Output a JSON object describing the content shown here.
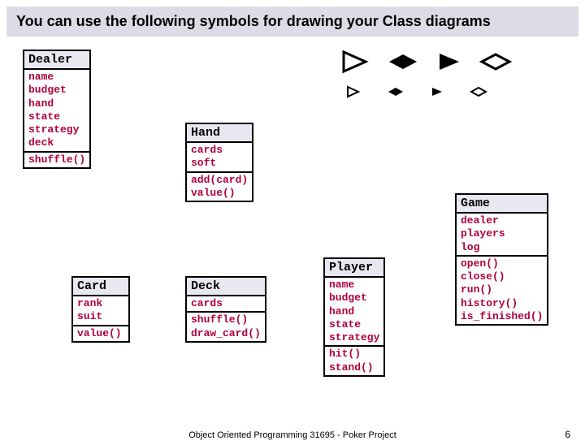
{
  "title": "You can use the following symbols for drawing your Class diagrams",
  "footer": "Object Oriented Programming 31695 - Poker Project",
  "page_number": "6",
  "classes": {
    "dealer": {
      "name": "Dealer",
      "attrs": [
        "name",
        "budget",
        "hand",
        "state",
        "strategy",
        "deck"
      ],
      "methods": [
        "shuffle()"
      ]
    },
    "hand": {
      "name": "Hand",
      "attrs": [
        "cards",
        "soft"
      ],
      "methods": [
        "add(card)",
        "value()"
      ]
    },
    "card": {
      "name": "Card",
      "attrs": [
        "rank",
        "suit"
      ],
      "methods": [
        "value()"
      ]
    },
    "deck": {
      "name": "Deck",
      "attrs": [
        "cards"
      ],
      "methods": [
        "shuffle()",
        "draw_card()"
      ]
    },
    "player": {
      "name": "Player",
      "attrs": [
        "name",
        "budget",
        "hand",
        "state",
        "strategy"
      ],
      "methods": [
        "hit()",
        "stand()"
      ]
    },
    "game": {
      "name": "Game",
      "attrs": [
        "dealer",
        "players",
        "log"
      ],
      "methods": [
        "open()",
        "close()",
        "run()",
        "history()",
        "is_finished()"
      ]
    }
  },
  "symbols": {
    "large": [
      "open-triangle-right",
      "filled-diamond",
      "filled-triangle-right",
      "open-diamond"
    ],
    "small": [
      "open-triangle-right",
      "filled-diamond",
      "filled-triangle-right",
      "open-diamond"
    ]
  }
}
